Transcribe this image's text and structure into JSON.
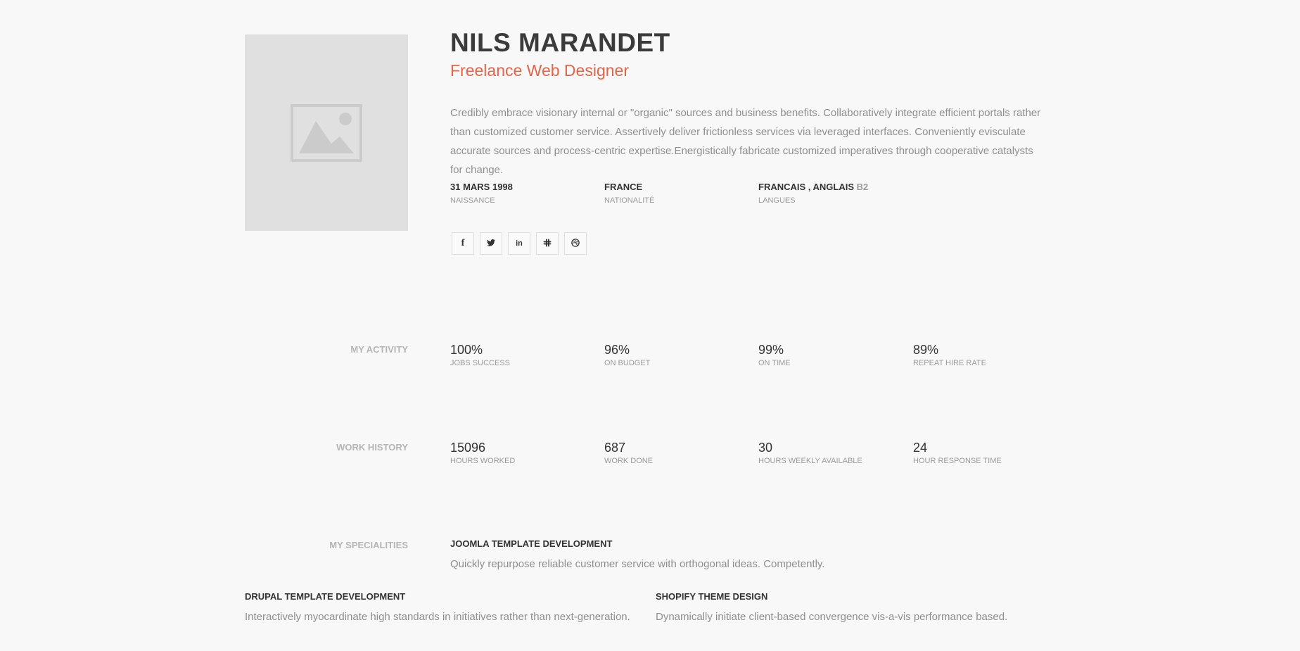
{
  "profile": {
    "name": "NILS MARANDET",
    "role": "Freelance Web Designer",
    "bio": "Credibly embrace visionary internal or \"organic\" sources and business benefits. Collaboratively integrate efficient portals rather than customized customer service. Assertively deliver frictionless services via leveraged interfaces. Conveniently evisculate accurate sources and process-centric expertise.Energistically fabricate customized imperatives through cooperative catalysts for change.",
    "avatar_icon": "image-placeholder-icon",
    "accent_color": "#e2654a"
  },
  "facts": [
    {
      "value": "31 MARS 1998",
      "label": "NAISSANCE"
    },
    {
      "value": "FRANCE",
      "label": "NATIONALITÉ"
    },
    {
      "value": "FRANCAIS , ANGLAIS",
      "extra": "B2",
      "label": "LANGUES"
    }
  ],
  "socials": [
    {
      "icon": "facebook-icon",
      "glyph": "f"
    },
    {
      "icon": "twitter-icon",
      "glyph": "🐦"
    },
    {
      "icon": "linkedin-icon",
      "glyph": "in"
    },
    {
      "icon": "slack-icon",
      "glyph": "✱"
    },
    {
      "icon": "dribbble-icon",
      "glyph": "◎"
    }
  ],
  "activity": {
    "label": "MY ACTIVITY",
    "stats": [
      {
        "value": "100%",
        "label": "JOBS SUCCESS"
      },
      {
        "value": "96%",
        "label": "ON BUDGET"
      },
      {
        "value": "99%",
        "label": "ON TIME"
      },
      {
        "value": "89%",
        "label": "REPEAT HIRE RATE"
      }
    ]
  },
  "work_history": {
    "label": "WORK HISTORY",
    "stats": [
      {
        "value": "15096",
        "label": "HOURS WORKED"
      },
      {
        "value": "687",
        "label": "WORK DONE"
      },
      {
        "value": "30",
        "label": "HOURS WEEKLY AVAILABLE"
      },
      {
        "value": "24",
        "label": "HOUR RESPONSE TIME"
      }
    ]
  },
  "specialities": {
    "label": "MY SPECIALITIES",
    "items": [
      {
        "title": "JOOMLA TEMPLATE DEVELOPMENT",
        "desc": "Quickly repurpose reliable customer service with orthogonal ideas. Competently."
      },
      {
        "title": "DRUPAL TEMPLATE DEVELOPMENT",
        "desc": "Interactively myocardinate high standards in initiatives rather than next-generation."
      },
      {
        "title": "SHOPIFY THEME DESIGN",
        "desc": "Dynamically initiate client-based convergence vis-a-vis performance based."
      }
    ]
  }
}
